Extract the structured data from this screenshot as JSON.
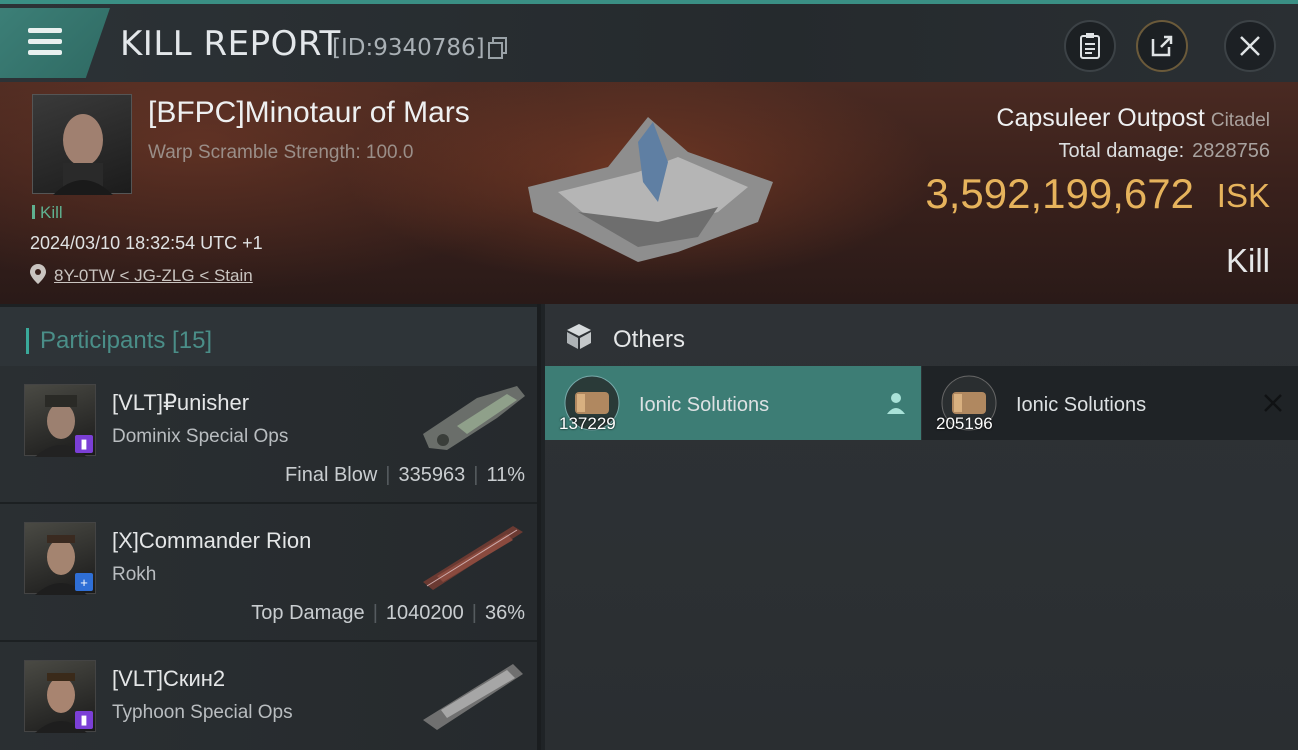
{
  "header": {
    "title": "KILL REPORT",
    "report_id": "[ID:9340786]",
    "icons": [
      "menu-icon",
      "copy-icon",
      "clipboard-icon",
      "share-icon",
      "close-icon"
    ]
  },
  "victim": {
    "name": "[BFPC]Minotaur of Mars",
    "subtitle": "Warp Scramble Strength: 100.0",
    "kill_tag": "Kill",
    "datetime": "2024/03/10 18:32:54 UTC +1",
    "location": "8Y-0TW < JG-ZLG < Stain"
  },
  "target": {
    "name": "Capsuleer Outpost",
    "class": "Citadel",
    "total_damage_label": "Total damage:",
    "total_damage_value": "2828756",
    "isk_value": "3,592,199,672",
    "isk_unit": "ISK",
    "result": "Kill"
  },
  "participants": {
    "title": "Participants [15]",
    "rows": [
      {
        "name": "[VLT]₽unisher",
        "ship": "Dominix Special Ops",
        "tag": "Final Blow",
        "damage": "335963",
        "percent": "11%",
        "badge": "purple"
      },
      {
        "name": "[X]Commander Rion",
        "ship": "Rokh",
        "tag": "Top Damage",
        "damage": "1040200",
        "percent": "36%",
        "badge": "blue"
      },
      {
        "name": "[VLT]Скин2",
        "ship": "Typhoon Special Ops",
        "tag": "",
        "damage": "",
        "percent": "",
        "badge": "purple"
      }
    ]
  },
  "others": {
    "title": "Others",
    "items": [
      {
        "name": "Ionic Solutions",
        "qty": "137229",
        "selected": true
      },
      {
        "name": "Ionic Solutions",
        "qty": "205196",
        "selected": false
      }
    ]
  },
  "colors": {
    "accent_teal": "#3d7d75",
    "isk_gold": "#e6b35c",
    "kill_green": "#5fb08f"
  }
}
